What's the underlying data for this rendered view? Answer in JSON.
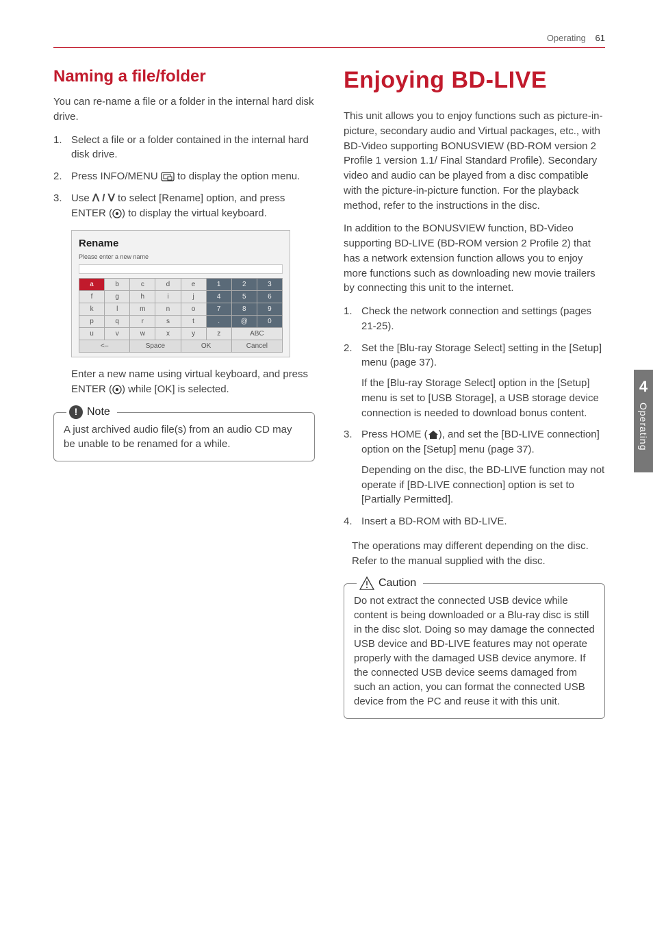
{
  "header": {
    "section": "Operating",
    "page_number": "61"
  },
  "side_tab": {
    "number": "4",
    "label": "Operating"
  },
  "left": {
    "title": "Naming a file/folder",
    "intro": "You can re-name a file or a folder in the internal hard disk drive.",
    "steps": [
      {
        "text": "Select a file or a folder contained in the internal hard disk drive."
      },
      {
        "before": "Press INFO/MENU ",
        "icon": "info-menu-icon",
        "after": " to display the option menu."
      },
      {
        "before": "Use ",
        "glyph": "ᐱ / ᐯ",
        "mid": " to select [Rename] option, and press ENTER (",
        "icon": "enter-icon",
        "after": ") to display the virtual keyboard."
      }
    ],
    "keyboard": {
      "title": "Rename",
      "subtitle": "Please enter a new name",
      "rows": [
        [
          "a",
          "b",
          "c",
          "d",
          "e",
          "1",
          "2",
          "3"
        ],
        [
          "f",
          "g",
          "h",
          "i",
          "j",
          "4",
          "5",
          "6"
        ],
        [
          "k",
          "l",
          "m",
          "n",
          "o",
          "7",
          "8",
          "9"
        ],
        [
          "p",
          "q",
          "r",
          "s",
          "t",
          ".",
          "@",
          "0"
        ],
        [
          "u",
          "v",
          "w",
          "x",
          "y",
          "z",
          "ABC",
          "ABC"
        ]
      ],
      "bottom": [
        "<–",
        "Space",
        "OK",
        "Cancel"
      ]
    },
    "after_kbd_before": "Enter a new name using virtual keyboard, and press ENTER (",
    "after_kbd_after": ") while [OK] is selected.",
    "note_label": "Note",
    "note_body": "A just archived audio file(s) from an audio CD may be unable to be renamed for a while."
  },
  "right": {
    "title": "Enjoying BD-LIVE",
    "p1": "This unit allows you to enjoy functions such as picture-in-picture, secondary audio and Virtual packages, etc., with BD-Video supporting BONUSVIEW (BD-ROM version 2 Profile 1 version 1.1/ Final Standard Profile). Secondary video and audio can be played from a disc compatible with the picture-in-picture function. For the playback method, refer to the instructions in the disc.",
    "p2": "In addition to the BONUSVIEW function, BD-Video supporting BD-LIVE (BD-ROM version 2 Profile 2) that has a network extension function allows you to enjoy more functions such as downloading new movie trailers by connecting this unit to the internet.",
    "steps": [
      {
        "text": "Check the network connection and settings (pages 21-25)."
      },
      {
        "text": "Set the [Blu-ray Storage Select] setting in the [Setup] menu (page 37).",
        "sub": "If the [Blu-ray Storage Select] option in the [Setup] menu is set to [USB Storage], a USB storage device connection is needed to download bonus content."
      },
      {
        "before": "Press HOME (",
        "icon": "home-icon",
        "after": "), and set the [BD-LIVE connection] option on the [Setup] menu (page 37).",
        "sub": "Depending on the disc, the BD-LIVE function may not operate if [BD-LIVE connection] option is set to [Partially Permitted]."
      },
      {
        "text": "Insert a BD-ROM with BD-LIVE."
      }
    ],
    "closing": "The operations may different depending on the disc. Refer to the manual supplied with the disc.",
    "caution_label": "Caution",
    "caution_body": "Do not extract the connected USB device while content is being downloaded or a Blu-ray disc is still in the disc slot. Doing so may damage the connected USB device and BD-LIVE features may not operate properly with the damaged USB device anymore. If the connected USB device seems damaged from such an action, you can format the connected USB device from the PC and reuse it with this unit."
  }
}
